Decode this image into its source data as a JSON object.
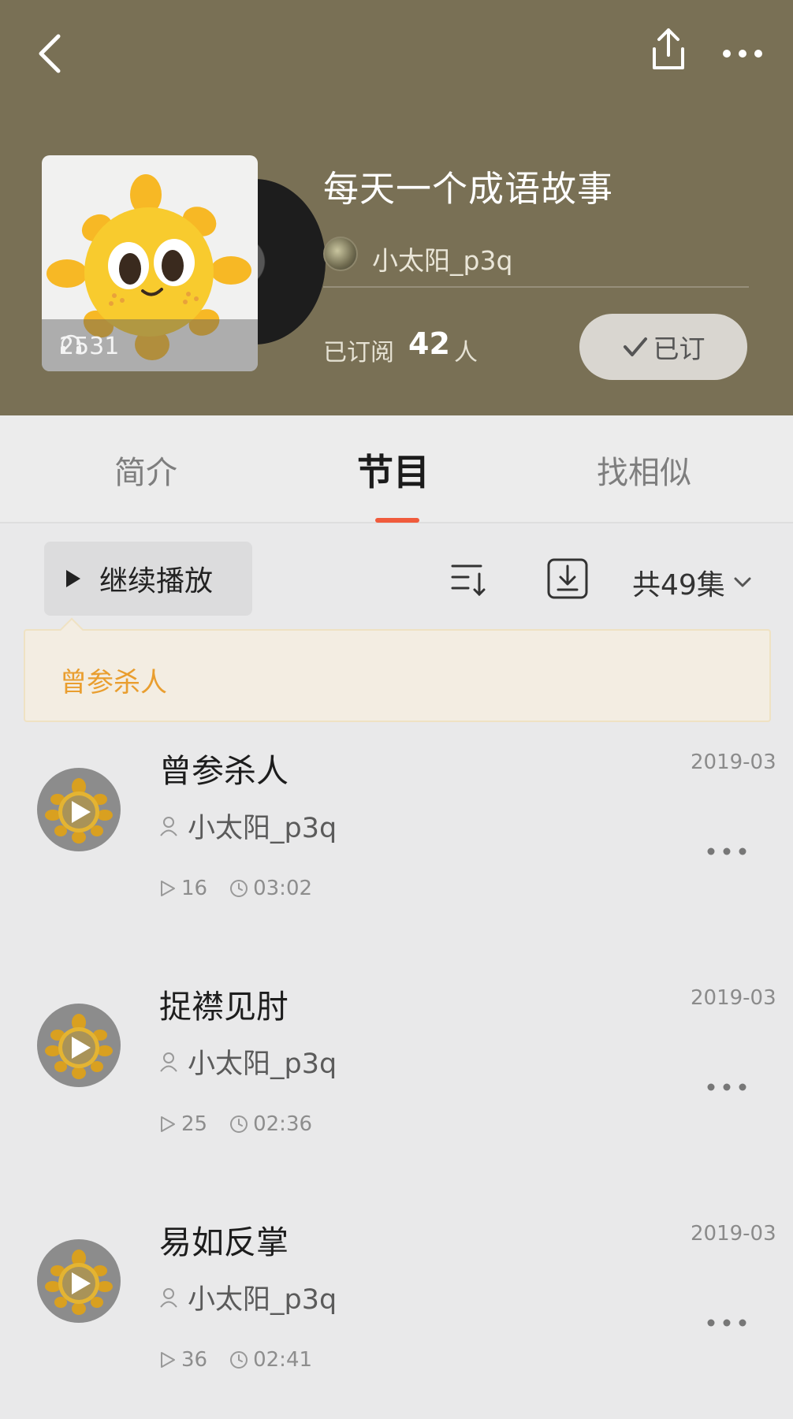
{
  "album": {
    "title": "每天一个成语故事",
    "author": "小太阳_p3q",
    "play_count": "2531",
    "subscribe_label": "已订阅",
    "subscribe_count": "42",
    "subscribe_unit": "人",
    "subscribed_button": "已订"
  },
  "icons": {
    "back": "chevron-left-icon",
    "share": "share-icon",
    "more": "more-horizontal-icon",
    "headphones": "headphones-icon",
    "check": "check-icon",
    "play": "play-icon",
    "sort": "sort-icon",
    "download": "download-icon",
    "user": "user-icon",
    "clock": "clock-icon"
  },
  "colors": {
    "header_bg": "#797055",
    "tab_indicator": "#f05b3c",
    "tip_text": "#e99e2f",
    "tip_bg": "#f3ede2"
  },
  "tabs": [
    {
      "label": "简介",
      "active": false
    },
    {
      "label": "节目",
      "active": true
    },
    {
      "label": "找相似",
      "active": false
    }
  ],
  "toolbar": {
    "continue_label": "继续播放",
    "episode_total": "共49集"
  },
  "tip": {
    "text": "曾参杀人"
  },
  "episodes": [
    {
      "title": "曾参杀人",
      "author": "小太阳_p3q",
      "date": "2019-03",
      "plays": "16",
      "duration": "03:02"
    },
    {
      "title": "捉襟见肘",
      "author": "小太阳_p3q",
      "date": "2019-03",
      "plays": "25",
      "duration": "02:36"
    },
    {
      "title": "易如反掌",
      "author": "小太阳_p3q",
      "date": "2019-03",
      "plays": "36",
      "duration": "02:41"
    }
  ]
}
